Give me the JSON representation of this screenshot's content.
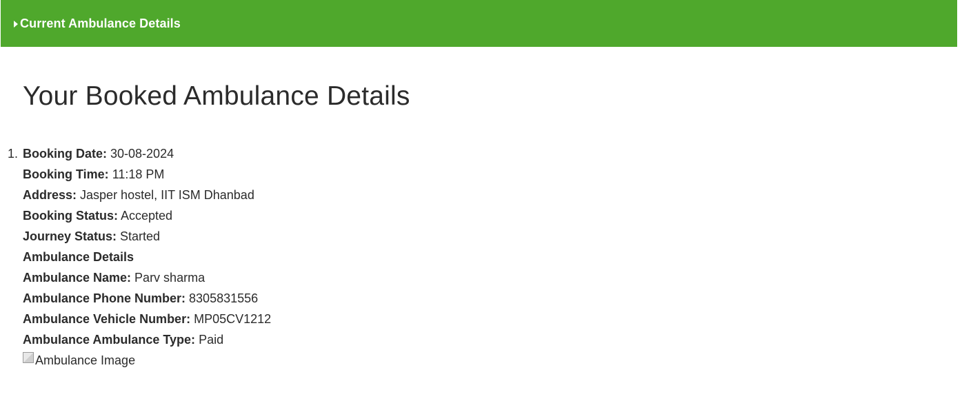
{
  "header": {
    "toggle_label": "Current Ambulance Details"
  },
  "page": {
    "heading": "Your Booked Ambulance Details"
  },
  "bookings": [
    {
      "index": "1.",
      "fields": [
        {
          "label": "Booking Date:",
          "value": " 30-08-2024"
        },
        {
          "label": "Booking Time:",
          "value": " 11:18 PM"
        },
        {
          "label": "Address:",
          "value": " Jasper hostel, IIT ISM Dhanbad"
        },
        {
          "label": "Booking Status:",
          "value": " Accepted"
        },
        {
          "label": "Journey Status:",
          "value": " Started"
        },
        {
          "label": "Ambulance Details",
          "value": ""
        },
        {
          "label": "Ambulance Name:",
          "value": " Parv sharma"
        },
        {
          "label": "Ambulance Phone Number:",
          "value": " 8305831556"
        },
        {
          "label": "Ambulance Vehicle Number:",
          "value": " MP05CV1212"
        },
        {
          "label": "Ambulance Ambulance Type:",
          "value": " Paid"
        }
      ],
      "image_alt": "Ambulance Image"
    }
  ]
}
